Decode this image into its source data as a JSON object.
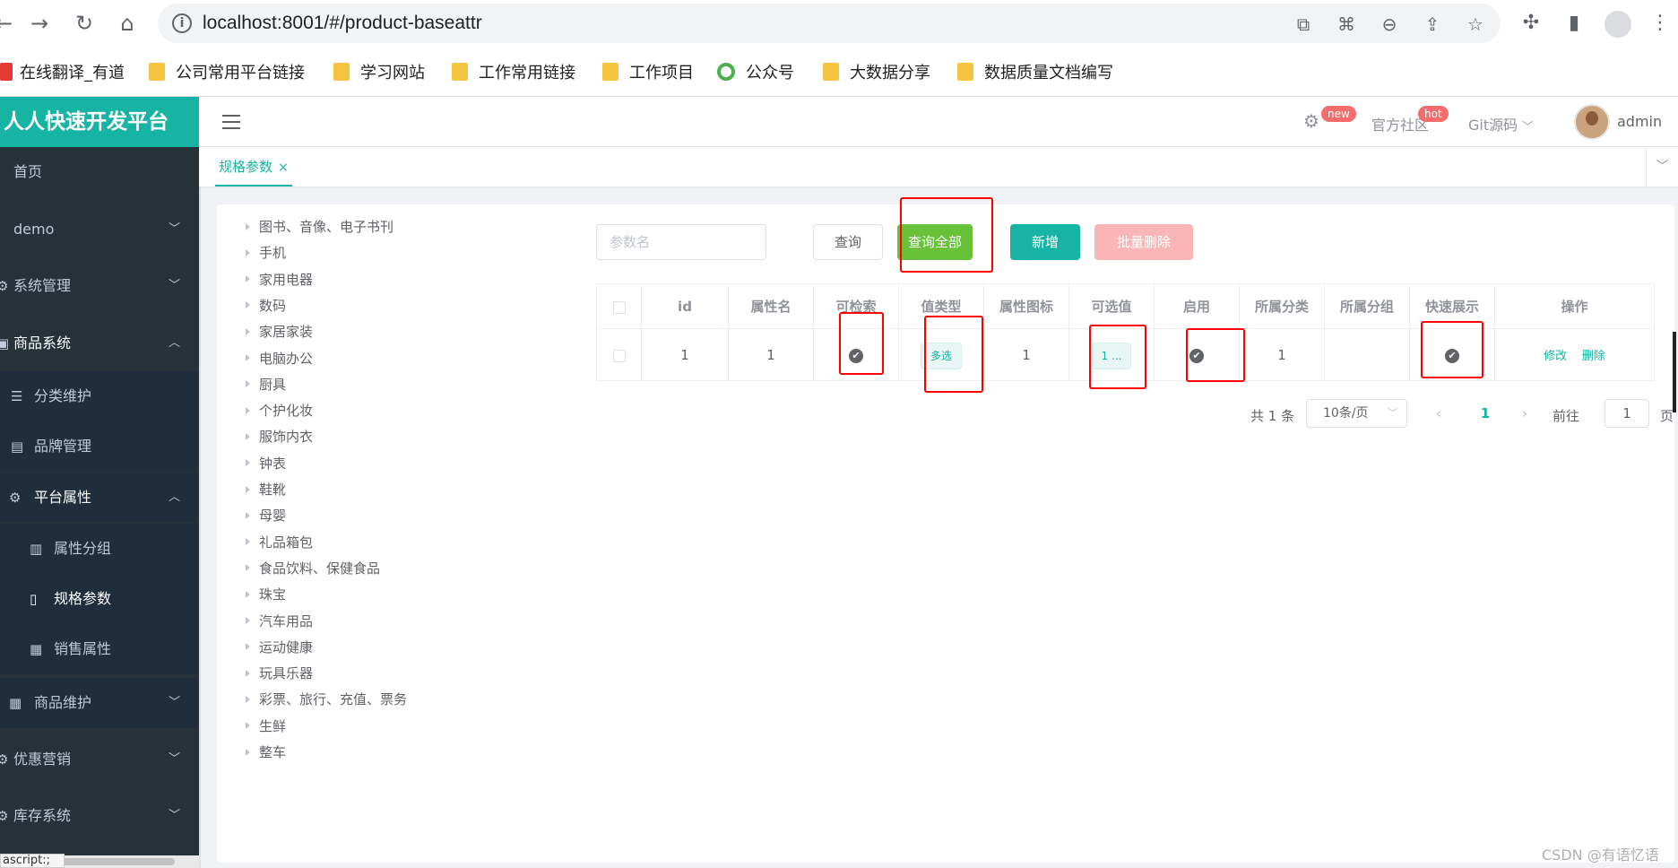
{
  "browser": {
    "url": "localhost:8001/#/product-baseattr",
    "bookmarks": [
      "在线翻译_有道",
      "公司常用平台链接",
      "学习网站",
      "工作常用链接",
      "工作项目",
      "公众号",
      "大数据分享",
      "数据质量文档编写"
    ]
  },
  "app": {
    "logo": "人人快速开发平台",
    "header": {
      "settings_badge": "new",
      "community": "官方社区",
      "community_badge": "hot",
      "git": "Git源码",
      "user": "admin"
    }
  },
  "sidebar": {
    "items": [
      {
        "label": "首页"
      },
      {
        "label": "demo"
      },
      {
        "label": "系统管理"
      },
      {
        "label": "商品系统"
      },
      {
        "label": "分类维护"
      },
      {
        "label": "品牌管理"
      },
      {
        "label": "平台属性"
      },
      {
        "label": "属性分组"
      },
      {
        "label": "规格参数"
      },
      {
        "label": "销售属性"
      },
      {
        "label": "商品维护"
      },
      {
        "label": "优惠营销"
      },
      {
        "label": "库存系统"
      }
    ],
    "status_tooltip": "ascript:;"
  },
  "tabs": [
    {
      "label": "规格参数",
      "close": "×"
    }
  ],
  "tree": [
    "图书、音像、电子书刊",
    "手机",
    "家用电器",
    "数码",
    "家居家装",
    "电脑办公",
    "厨具",
    "个护化妆",
    "服饰内衣",
    "钟表",
    "鞋靴",
    "母婴",
    "礼品箱包",
    "食品饮料、保健食品",
    "珠宝",
    "汽车用品",
    "运动健康",
    "玩具乐器",
    "彩票、旅行、充值、票务",
    "生鲜",
    "整车"
  ],
  "toolbar": {
    "search_placeholder": "参数名",
    "query": "查询",
    "query_all": "查询全部",
    "add": "新增",
    "batch_delete": "批量删除"
  },
  "table": {
    "headers": [
      "id",
      "属性名",
      "可检索",
      "值类型",
      "属性图标",
      "可选值",
      "启用",
      "所属分类",
      "所属分组",
      "快速展示",
      "操作"
    ],
    "rows": [
      {
        "id": "1",
        "name": "1",
        "search_type": "✔",
        "value_type": "多选",
        "icon": "1",
        "value_select": "1 ...",
        "enable": "✔",
        "catelog": "1",
        "group": "",
        "show_desc": "✔",
        "edit": "修改",
        "delete": "删除"
      }
    ]
  },
  "pagination": {
    "total": "共 1 条",
    "page_size": "10条/页",
    "prev": "‹",
    "current": "1",
    "next": "›",
    "goto_prefix": "前往",
    "goto_value": "1",
    "goto_suffix": "页"
  },
  "watermark": "CSDN @有语忆语"
}
